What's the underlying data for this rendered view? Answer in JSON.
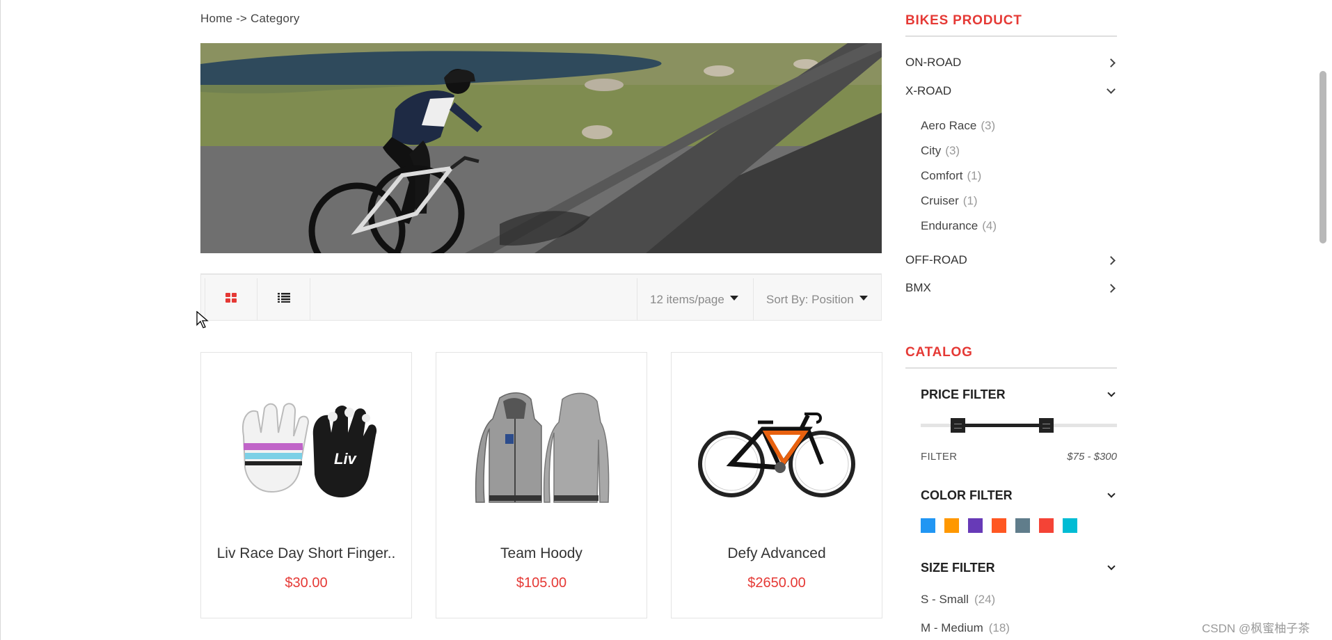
{
  "breadcrumb": {
    "text": "Home -> Category"
  },
  "toolbar": {
    "items_per_page": "12 items/page",
    "sort_by": "Sort By: Position"
  },
  "colors": {
    "accent": "#e53935",
    "swatches": [
      "#2196f3",
      "#ff9800",
      "#673ab7",
      "#ff5722",
      "#607d8b",
      "#f44336",
      "#00bcd4"
    ]
  },
  "products": [
    {
      "name": "Liv Race Day Short Finger..",
      "price": "$30.00",
      "icon": "gloves-image"
    },
    {
      "name": "Team Hoody",
      "price": "$105.00",
      "icon": "hoody-image"
    },
    {
      "name": "Defy Advanced",
      "price": "$2650.00",
      "icon": "bike-image"
    }
  ],
  "sidebar": {
    "bikes_title": "BIKES PRODUCT",
    "categories": [
      {
        "label": "ON-ROAD",
        "expanded": false
      },
      {
        "label": "X-ROAD",
        "expanded": true
      },
      {
        "label": "OFF-ROAD",
        "expanded": false
      },
      {
        "label": "BMX",
        "expanded": false
      }
    ],
    "xroad_items": [
      {
        "label": "Aero Race",
        "count": "(3)"
      },
      {
        "label": "City",
        "count": "(3)"
      },
      {
        "label": "Comfort",
        "count": "(1)"
      },
      {
        "label": "Cruiser",
        "count": "(1)"
      },
      {
        "label": "Endurance",
        "count": "(4)"
      }
    ],
    "catalog_title": "CATALOG",
    "price_filter": {
      "title": "PRICE FILTER",
      "label": "FILTER",
      "range": "$75 - $300"
    },
    "color_filter": {
      "title": "COLOR FILTER"
    },
    "size_filter": {
      "title": "SIZE FILTER",
      "sizes": [
        {
          "label": "S - Small",
          "count": "(24)"
        },
        {
          "label": "M - Medium",
          "count": "(18)"
        }
      ]
    }
  },
  "watermark": "CSDN @枫蜜柚子茶"
}
